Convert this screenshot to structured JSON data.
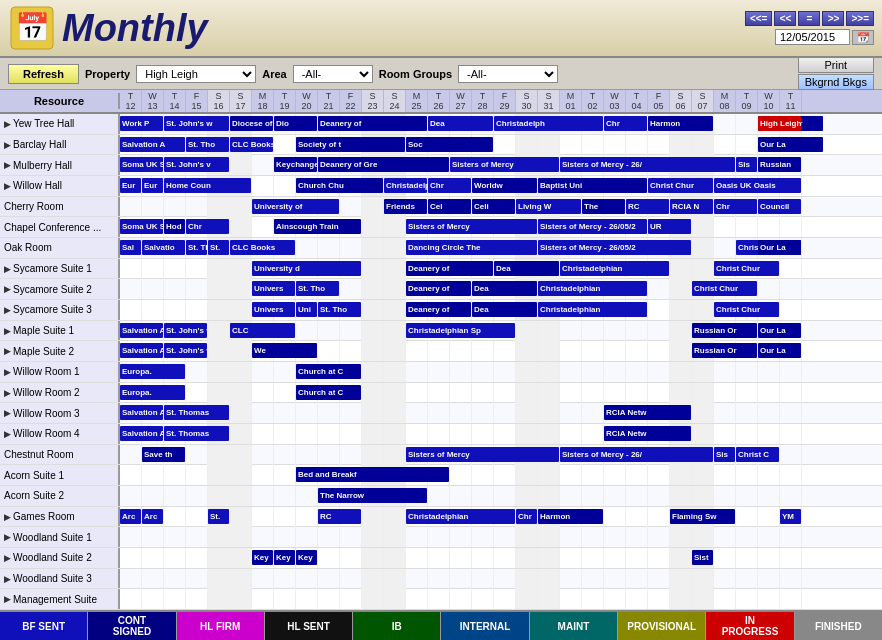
{
  "header": {
    "title": "Monthly",
    "date": "12/05/2015",
    "nav_buttons": [
      "<<=",
      "<<",
      "=",
      ">>",
      ">>="
    ]
  },
  "toolbar": {
    "refresh_label": "Refresh",
    "property_label": "Property",
    "property_value": "High Leigh",
    "area_label": "Area",
    "area_value": "-All-",
    "room_groups_label": "Room Groups",
    "room_groups_value": "-All-",
    "print_label": "Print",
    "bkgrnd_label": "Bkgrnd Bkgs"
  },
  "calendar": {
    "resource_header": "Resource",
    "days": [
      {
        "letter": "T",
        "num": "12"
      },
      {
        "letter": "W",
        "num": "13"
      },
      {
        "letter": "T",
        "num": "14"
      },
      {
        "letter": "F",
        "num": "15"
      },
      {
        "letter": "S",
        "num": "16"
      },
      {
        "letter": "S",
        "num": "17"
      },
      {
        "letter": "M",
        "num": "18"
      },
      {
        "letter": "T",
        "num": "19"
      },
      {
        "letter": "W",
        "num": "20"
      },
      {
        "letter": "T",
        "num": "21"
      },
      {
        "letter": "F",
        "num": "22"
      },
      {
        "letter": "S",
        "num": "23"
      },
      {
        "letter": "S",
        "num": "24"
      },
      {
        "letter": "M",
        "num": "25"
      },
      {
        "letter": "T",
        "num": "26"
      },
      {
        "letter": "W",
        "num": "27"
      },
      {
        "letter": "T",
        "num": "28"
      },
      {
        "letter": "F",
        "num": "29"
      },
      {
        "letter": "S",
        "num": "30"
      },
      {
        "letter": "S",
        "num": "31"
      },
      {
        "letter": "M",
        "num": "01"
      },
      {
        "letter": "T",
        "num": "02"
      },
      {
        "letter": "W",
        "num": "03"
      },
      {
        "letter": "T",
        "num": "04"
      },
      {
        "letter": "F",
        "num": "05"
      },
      {
        "letter": "S",
        "num": "06"
      },
      {
        "letter": "S",
        "num": "07"
      },
      {
        "letter": "M",
        "num": "08"
      },
      {
        "letter": "T",
        "num": "09"
      },
      {
        "letter": "W",
        "num": "10"
      },
      {
        "letter": "T",
        "num": "11"
      }
    ],
    "resources": [
      "Yew Tree Hall",
      "Barclay Hall",
      "Mulberry Hall",
      "Willow Hall",
      "Cherry Room",
      "Chapel Conference ...",
      "Oak Room",
      "Sycamore Suite 1",
      "Sycamore Suite 2",
      "Sycamore Suite 3",
      "Maple Suite 1",
      "Maple Suite 2",
      "Willow Room 1",
      "Willow Room 2",
      "Willow Room 3",
      "Willow Room 4",
      "Chestnut Room",
      "Acorn Suite 1",
      "Acorn Suite 2",
      "Games Room",
      "Woodland Suite 1",
      "Woodland Suite 2",
      "Woodland Suite 3",
      "Management Suite"
    ]
  },
  "legend": [
    {
      "label": "BF SENT",
      "class": "bf-sent"
    },
    {
      "label": "CONT\nSIGNED",
      "class": "cont-signed"
    },
    {
      "label": "HL FIRM",
      "class": "hl-firm"
    },
    {
      "label": "HL SENT",
      "class": "hl-sent"
    },
    {
      "label": "IB",
      "class": "ib"
    },
    {
      "label": "INTERNAL",
      "class": "internal"
    },
    {
      "label": "MAINT",
      "class": "maint"
    },
    {
      "label": "PROVISIONAL",
      "class": "provisional"
    },
    {
      "label": "IN\nPROGRESS",
      "class": "in-progress"
    },
    {
      "label": "FINISHED",
      "class": "finished"
    }
  ]
}
